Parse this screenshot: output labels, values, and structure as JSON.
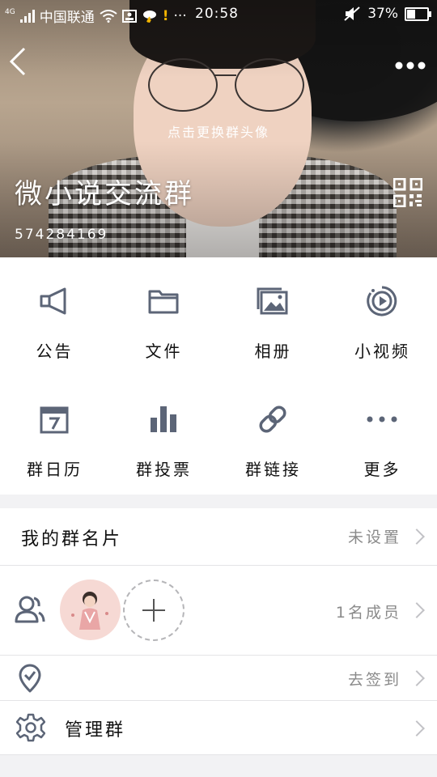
{
  "status_bar": {
    "network": "4G",
    "carrier": "中国联通",
    "time": "20:58",
    "battery": "37%",
    "notification_dots": "···"
  },
  "header": {
    "change_avatar_hint": "点击更换群头像",
    "group_name": "微小说交流群",
    "group_id": "574284169"
  },
  "grid": [
    {
      "label": "公告",
      "icon": "megaphone-icon"
    },
    {
      "label": "文件",
      "icon": "folder-icon"
    },
    {
      "label": "相册",
      "icon": "photo-album-icon"
    },
    {
      "label": "小视频",
      "icon": "video-play-icon"
    },
    {
      "label": "群日历",
      "icon": "calendar-icon"
    },
    {
      "label": "群投票",
      "icon": "bar-chart-icon"
    },
    {
      "label": "群链接",
      "icon": "link-icon"
    },
    {
      "label": "更多",
      "icon": "more-dots-icon"
    }
  ],
  "rows": {
    "card": {
      "label": "我的群名片",
      "value": "未设置"
    },
    "members": {
      "value": "1名成员"
    },
    "checkin": {
      "value": "去签到"
    },
    "manage": {
      "label": "管理群"
    }
  },
  "colors": {
    "icon": "#5c6577",
    "divider": "#e4e4e6",
    "secondary_text": "#8a8a8a"
  }
}
